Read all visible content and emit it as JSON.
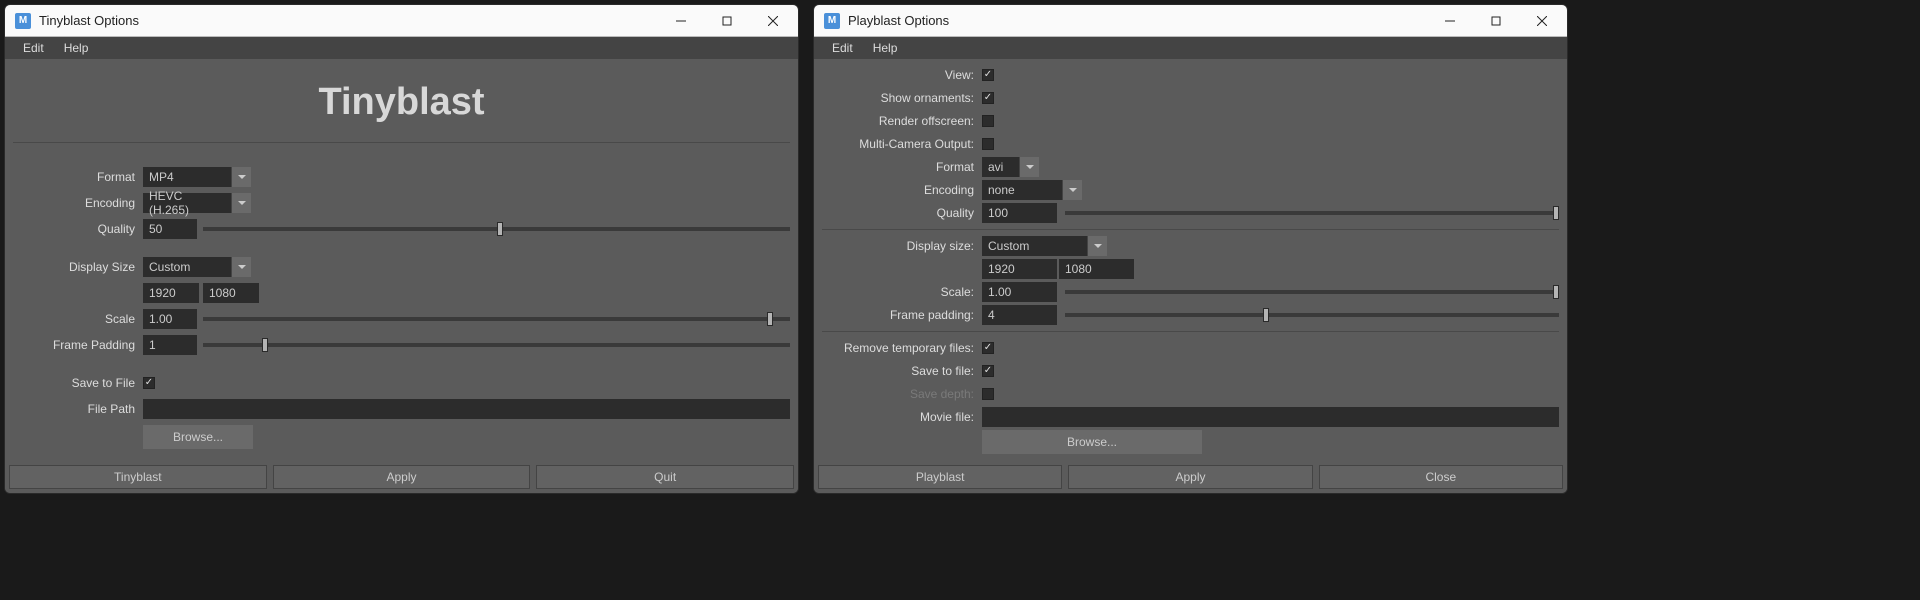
{
  "left": {
    "title": "Tinyblast Options",
    "menu": {
      "edit": "Edit",
      "help": "Help"
    },
    "heading": "Tinyblast",
    "labels": {
      "format": "Format",
      "encoding": "Encoding",
      "quality": "Quality",
      "displaySize": "Display Size",
      "scale": "Scale",
      "framePadding": "Frame Padding",
      "saveToFile": "Save to File",
      "filePath": "File Path"
    },
    "values": {
      "format": "MP4",
      "encoding": "HEVC (H.265)",
      "quality": "50",
      "displaySize": "Custom",
      "width": "1920",
      "height": "1080",
      "scale": "1.00",
      "framePadding": "1",
      "saveToFile": true,
      "filePath": ""
    },
    "buttons": {
      "browse": "Browse...",
      "tinyblast": "Tinyblast",
      "apply": "Apply",
      "quit": "Quit"
    }
  },
  "right": {
    "title": "Playblast Options",
    "menu": {
      "edit": "Edit",
      "help": "Help"
    },
    "labels": {
      "view": "View:",
      "showOrnaments": "Show ornaments:",
      "renderOffscreen": "Render offscreen:",
      "multiCamera": "Multi-Camera Output:",
      "format": "Format",
      "encoding": "Encoding",
      "quality": "Quality",
      "displaySize": "Display size:",
      "scale": "Scale:",
      "framePadding": "Frame padding:",
      "removeTemp": "Remove temporary files:",
      "saveToFile": "Save to file:",
      "saveDepth": "Save depth:",
      "movieFile": "Movie file:"
    },
    "values": {
      "view": true,
      "showOrnaments": true,
      "renderOffscreen": false,
      "multiCamera": false,
      "format": "avi",
      "encoding": "none",
      "quality": "100",
      "displaySize": "Custom",
      "width": "1920",
      "height": "1080",
      "scale": "1.00",
      "framePadding": "4",
      "removeTemp": true,
      "saveToFile": true,
      "saveDepth": false,
      "movieFile": ""
    },
    "buttons": {
      "browse": "Browse...",
      "playblast": "Playblast",
      "apply": "Apply",
      "close": "Close"
    }
  }
}
